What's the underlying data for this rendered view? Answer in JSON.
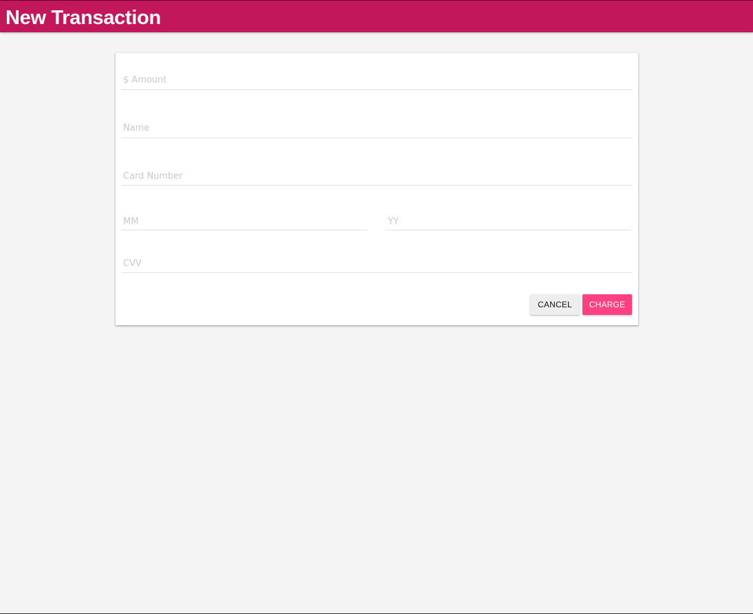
{
  "header": {
    "title": "New Transaction",
    "color": "#c2185b"
  },
  "form": {
    "amount_placeholder": "$ Amount",
    "name_placeholder": "Name",
    "card_number_placeholder": "Card Number",
    "month_placeholder": "MM",
    "year_placeholder": "YY",
    "cvv_placeholder": "CVV"
  },
  "actions": {
    "cancel_label": "CANCEL",
    "charge_label": "CHARGE",
    "charge_color": "#ff4081"
  }
}
